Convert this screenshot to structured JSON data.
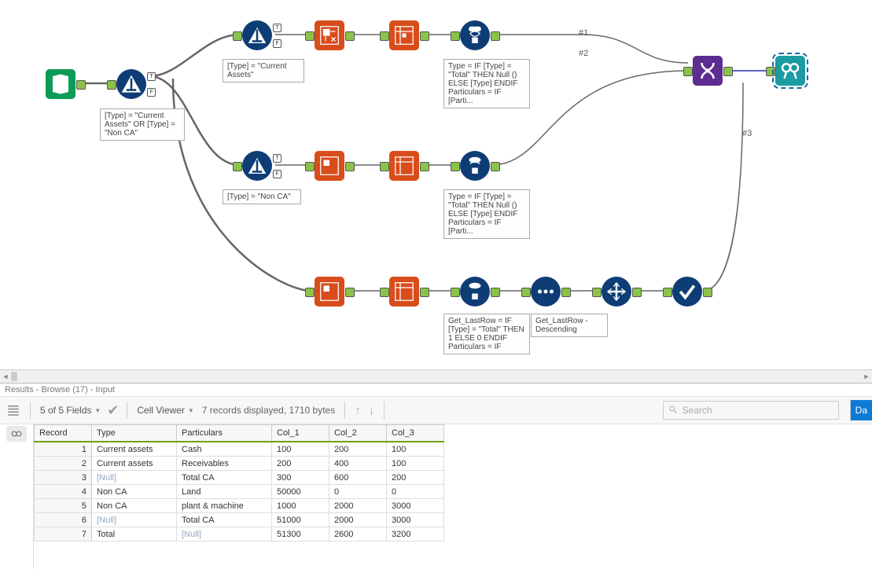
{
  "canvas": {
    "filter1_annot": "[Type] = \"Current Assets\" OR [Type] = \"Non CA\"",
    "filter2_annot": "[Type] = \"Current Assets\"",
    "filter3_annot": "[Type] = \"Non CA\"",
    "formula1_annot": "Type = IF [Type] = \"Total\" THEN Null () ELSE [Type] ENDIF\nParticulars = IF [Parti...",
    "formula2_annot": "Type = IF [Type] = \"Total\" THEN Null () ELSE [Type] ENDIF\nParticulars = IF [Parti...",
    "formula3_annot": "Get_LastRow = IF [Type] = \"Total\" THEN 1 ELSE 0 ENDIF\nParticulars = IF",
    "sort_annot": "Get_LastRow - Descending",
    "edge_labels": {
      "e1": "#1",
      "e2": "#2",
      "e3": "#3"
    }
  },
  "results": {
    "header": "Results - Browse (17) - Input",
    "fields_summary": "5 of 5 Fields",
    "cell_viewer": "Cell Viewer",
    "status": "7 records displayed, 1710 bytes",
    "search_placeholder": "Search",
    "data_btn": "Da",
    "columns": [
      "Record",
      "Type",
      "Particulars",
      "Col_1",
      "Col_2",
      "Col_3"
    ],
    "rows": [
      {
        "idx": "1",
        "type": "Current assets",
        "part": "Cash",
        "c1": "100",
        "c2": "200",
        "c3": "100"
      },
      {
        "idx": "2",
        "type": "Current assets",
        "part": "Receivables",
        "c1": "200",
        "c2": "400",
        "c3": "100"
      },
      {
        "idx": "3",
        "type": "[Null]",
        "part": "Total CA",
        "c1": "300",
        "c2": "600",
        "c3": "200",
        "type_null": true
      },
      {
        "idx": "4",
        "type": "Non CA",
        "part": "Land",
        "c1": "50000",
        "c2": "0",
        "c3": "0"
      },
      {
        "idx": "5",
        "type": "Non CA",
        "part": "plant & machine",
        "c1": "1000",
        "c2": "2000",
        "c3": "3000"
      },
      {
        "idx": "6",
        "type": "[Null]",
        "part": "Total CA",
        "c1": "51000",
        "c2": "2000",
        "c3": "3000",
        "type_null": true
      },
      {
        "idx": "7",
        "type": "Total",
        "part": "[Null]",
        "c1": "51300",
        "c2": "2600",
        "c3": "3200",
        "part_null": true
      }
    ]
  }
}
